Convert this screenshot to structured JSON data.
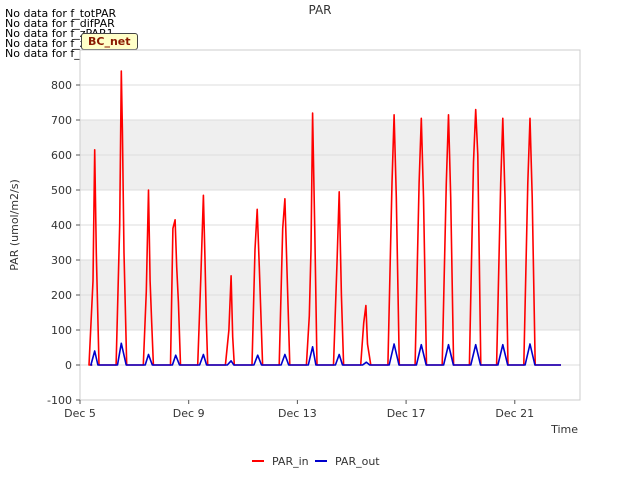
{
  "no_data_messages": [
    "No data for f_totPAR",
    "No data for f_difPAR",
    "No data for f_zPAR1",
    "No data for f_zPAR2",
    "No data for f_zPAR3"
  ],
  "badge_label": "BC_net",
  "colors": {
    "PAR_in": "#ff0000",
    "PAR_out": "#0000cc",
    "band": "#efefef"
  },
  "chart_data": {
    "type": "line",
    "title": "PAR",
    "xlabel": "Time",
    "ylabel": "PAR (umol/m2/s)",
    "ylim": [
      -100,
      900
    ],
    "xlim": [
      0,
      18.4
    ],
    "yticks": [
      -100,
      0,
      100,
      200,
      300,
      400,
      500,
      600,
      700,
      800
    ],
    "xticks": [
      {
        "x": 0,
        "label": "Dec 5"
      },
      {
        "x": 4,
        "label": "Dec 9"
      },
      {
        "x": 8,
        "label": "Dec 13"
      },
      {
        "x": 12,
        "label": "Dec 17"
      },
      {
        "x": 16,
        "label": "Dec 21"
      }
    ],
    "legend": "bottom-center",
    "series": [
      {
        "name": "PAR_in",
        "color": "#ff0000",
        "days": [
          {
            "start": 0.33,
            "end": 0.7,
            "peaks": [
              [
                0.48,
                240
              ],
              [
                0.54,
                615
              ],
              [
                0.6,
                320
              ]
            ]
          },
          {
            "start": 1.33,
            "end": 1.72,
            "peaks": [
              [
                1.46,
                400
              ],
              [
                1.52,
                840
              ],
              [
                1.56,
                670
              ],
              [
                1.62,
                320
              ]
            ]
          },
          {
            "start": 2.33,
            "end": 2.7,
            "peaks": [
              [
                2.44,
                210
              ],
              [
                2.52,
                500
              ],
              [
                2.58,
                240
              ],
              [
                2.64,
                120
              ]
            ]
          },
          {
            "start": 3.33,
            "end": 3.7,
            "peaks": [
              [
                3.42,
                390
              ],
              [
                3.5,
                415
              ],
              [
                3.56,
                280
              ],
              [
                3.62,
                180
              ]
            ]
          },
          {
            "start": 4.33,
            "end": 4.7,
            "peaks": [
              [
                4.44,
                240
              ],
              [
                4.54,
                485
              ],
              [
                4.6,
                300
              ],
              [
                4.65,
                120
              ]
            ]
          },
          {
            "start": 5.35,
            "end": 5.68,
            "peaks": [
              [
                5.48,
                100
              ],
              [
                5.56,
                255
              ],
              [
                5.62,
                80
              ]
            ]
          },
          {
            "start": 6.33,
            "end": 6.72,
            "peaks": [
              [
                6.44,
                330
              ],
              [
                6.52,
                445
              ],
              [
                6.6,
                280
              ]
            ]
          },
          {
            "start": 7.33,
            "end": 7.72,
            "peaks": [
              [
                7.46,
                390
              ],
              [
                7.54,
                475
              ],
              [
                7.62,
                260
              ]
            ]
          },
          {
            "start": 8.33,
            "end": 8.72,
            "peaks": [
              [
                8.44,
                140
              ],
              [
                8.5,
                330
              ],
              [
                8.56,
                720
              ],
              [
                8.64,
                380
              ]
            ]
          },
          {
            "start": 9.33,
            "end": 9.7,
            "peaks": [
              [
                9.46,
                300
              ],
              [
                9.54,
                495
              ],
              [
                9.62,
                200
              ]
            ]
          },
          {
            "start": 10.33,
            "end": 10.7,
            "peaks": [
              [
                10.44,
                120
              ],
              [
                10.52,
                170
              ],
              [
                10.58,
                60
              ]
            ]
          },
          {
            "start": 11.33,
            "end": 11.75,
            "peaks": [
              [
                11.48,
                520
              ],
              [
                11.56,
                715
              ],
              [
                11.64,
                480
              ]
            ]
          },
          {
            "start": 12.33,
            "end": 12.75,
            "peaks": [
              [
                12.48,
                520
              ],
              [
                12.56,
                705
              ],
              [
                12.64,
                480
              ]
            ]
          },
          {
            "start": 13.33,
            "end": 13.75,
            "peaks": [
              [
                13.48,
                520
              ],
              [
                13.56,
                715
              ],
              [
                13.64,
                480
              ]
            ]
          },
          {
            "start": 14.33,
            "end": 14.75,
            "peaks": [
              [
                14.48,
                580
              ],
              [
                14.56,
                730
              ],
              [
                14.64,
                600
              ]
            ]
          },
          {
            "start": 15.33,
            "end": 15.75,
            "peaks": [
              [
                15.48,
                520
              ],
              [
                15.56,
                705
              ],
              [
                15.64,
                480
              ]
            ]
          },
          {
            "start": 16.33,
            "end": 16.75,
            "peaks": [
              [
                16.48,
                520
              ],
              [
                16.56,
                705
              ],
              [
                16.64,
                480
              ]
            ]
          }
        ]
      },
      {
        "name": "PAR_out",
        "color": "#0000cc",
        "days": [
          {
            "start": 0.4,
            "end": 0.66,
            "peaks": [
              [
                0.54,
                40
              ]
            ]
          },
          {
            "start": 1.38,
            "end": 1.7,
            "peaks": [
              [
                1.52,
                62
              ]
            ]
          },
          {
            "start": 2.4,
            "end": 2.66,
            "peaks": [
              [
                2.52,
                30
              ]
            ]
          },
          {
            "start": 3.4,
            "end": 3.66,
            "peaks": [
              [
                3.52,
                28
              ]
            ]
          },
          {
            "start": 4.4,
            "end": 4.66,
            "peaks": [
              [
                4.54,
                30
              ]
            ]
          },
          {
            "start": 5.42,
            "end": 5.66,
            "peaks": [
              [
                5.56,
                12
              ]
            ]
          },
          {
            "start": 6.4,
            "end": 6.68,
            "peaks": [
              [
                6.54,
                28
              ]
            ]
          },
          {
            "start": 7.4,
            "end": 7.68,
            "peaks": [
              [
                7.54,
                30
              ]
            ]
          },
          {
            "start": 8.4,
            "end": 8.68,
            "peaks": [
              [
                8.56,
                52
              ]
            ]
          },
          {
            "start": 9.4,
            "end": 9.66,
            "peaks": [
              [
                9.54,
                30
              ]
            ]
          },
          {
            "start": 10.4,
            "end": 10.66,
            "peaks": [
              [
                10.54,
                8
              ]
            ]
          },
          {
            "start": 11.38,
            "end": 11.74,
            "peaks": [
              [
                11.56,
                60
              ]
            ]
          },
          {
            "start": 12.38,
            "end": 12.74,
            "peaks": [
              [
                12.56,
                58
              ]
            ]
          },
          {
            "start": 13.38,
            "end": 13.74,
            "peaks": [
              [
                13.56,
                58
              ]
            ]
          },
          {
            "start": 14.38,
            "end": 14.74,
            "peaks": [
              [
                14.56,
                58
              ]
            ]
          },
          {
            "start": 15.38,
            "end": 15.74,
            "peaks": [
              [
                15.56,
                58
              ]
            ]
          },
          {
            "start": 16.38,
            "end": 16.74,
            "peaks": [
              [
                16.56,
                60
              ]
            ]
          }
        ]
      }
    ]
  }
}
